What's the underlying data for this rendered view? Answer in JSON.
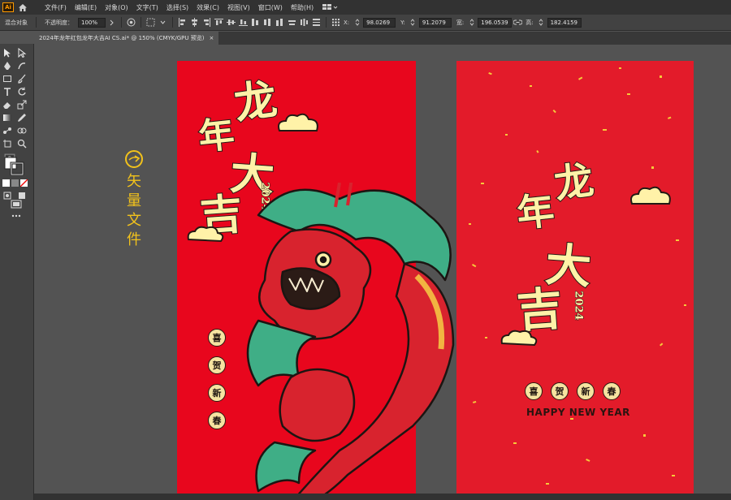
{
  "app": {
    "logo_text": "Ai"
  },
  "menu": [
    "文件(F)",
    "编辑(E)",
    "对象(O)",
    "文字(T)",
    "选择(S)",
    "效果(C)",
    "视图(V)",
    "窗口(W)",
    "帮助(H)"
  ],
  "control": {
    "object_type": "混合对象",
    "opacity_label": "不透明度：",
    "opacity_value": "100%",
    "x_label": "X:",
    "x_value": "98.0269",
    "y_label": "Y:",
    "y_value": "91.2079",
    "w_label": "宽:",
    "w_value": "196.0539",
    "h_label": "高:",
    "h_value": "182.4159"
  },
  "tab": {
    "title": "2024年龙年红包龙年大吉AI CS.ai* @ 150% (CMYK/GPU 预览)",
    "close": "×"
  },
  "side_label": {
    "chars": [
      "矢",
      "量",
      "文",
      "件"
    ]
  },
  "artboard1": {
    "title_chars": [
      "龙",
      "年",
      "大",
      "吉"
    ],
    "year": "2024",
    "badges": [
      "喜",
      "贺",
      "新",
      "春"
    ]
  },
  "artboard2": {
    "title_chars": [
      "龙",
      "年",
      "大",
      "吉"
    ],
    "year": "2024",
    "badges": [
      "喜",
      "贺",
      "新",
      "春"
    ],
    "english": "HAPPY NEW YEAR"
  },
  "colors": {
    "artboard1": "#e8061d",
    "artboard2": "#e31b2a",
    "gold": "#fff2a8",
    "label": "#f2c21b",
    "dragon_green": "#3fae86",
    "dragon_red": "#d8232e"
  }
}
